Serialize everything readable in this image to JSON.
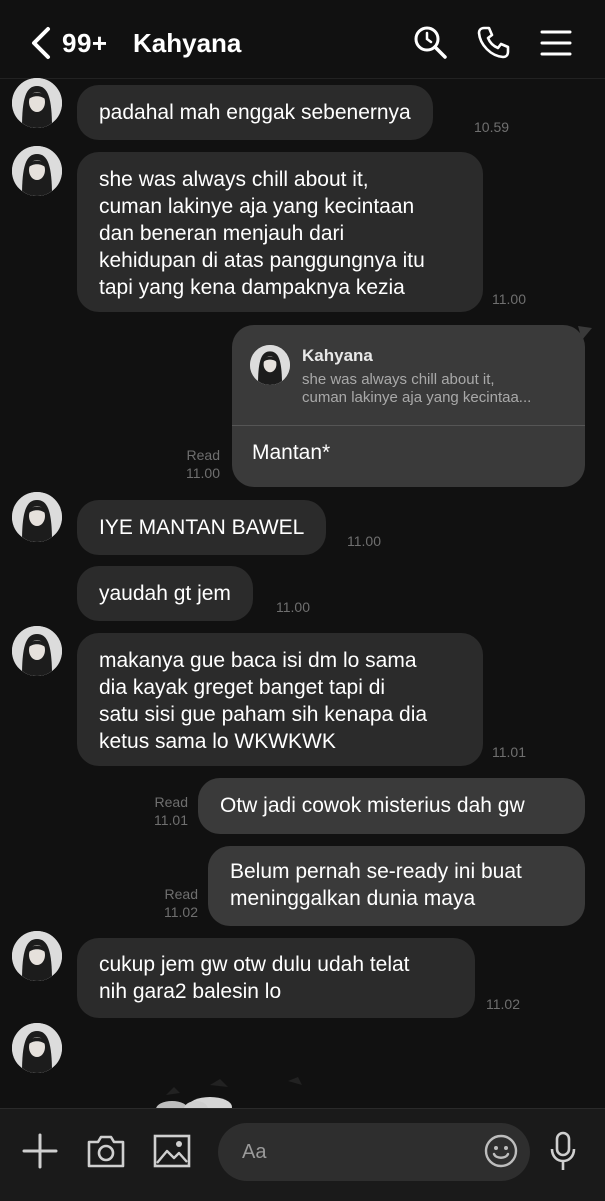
{
  "header": {
    "unread_count": "99+",
    "chat_name": "Kahyana"
  },
  "messages": [
    {
      "dir": "in",
      "lines": [
        "padahal mah enggak sebenernya"
      ],
      "time": "10.59"
    },
    {
      "dir": "in",
      "lines": [
        "she was always chill about it,",
        "cuman lakinye aja yang kecintaan",
        "dan beneran menjauh dari",
        "kehidupan di atas panggungnya itu",
        "tapi yang kena dampaknya kezia"
      ],
      "time": "11.00"
    },
    {
      "dir": "in",
      "lines": [
        "IYE MANTAN BAWEL"
      ],
      "time": "11.00"
    },
    {
      "dir": "in",
      "lines": [
        "yaudah gt jem"
      ],
      "time": "11.00"
    },
    {
      "dir": "in",
      "lines": [
        "makanya gue baca isi dm lo sama",
        "dia kayak greget banget tapi di",
        "satu sisi gue paham sih kenapa dia",
        "ketus sama lo WKWKWK"
      ],
      "time": "11.01"
    },
    {
      "dir": "out",
      "lines": [
        "Otw jadi cowok misterius dah gw"
      ],
      "status": "Read",
      "time": "11.01"
    },
    {
      "dir": "out",
      "lines": [
        "Belum pernah se-ready ini buat",
        "meninggalkan dunia maya"
      ],
      "status": "Read",
      "time": "11.02"
    },
    {
      "dir": "in",
      "lines": [
        "cukup jem gw otw dulu udah telat",
        "nih gara2 balesin lo"
      ],
      "time": "11.02"
    }
  ],
  "reply": {
    "quoted_name": "Kahyana",
    "quoted_line1": "she was always chill about it,",
    "quoted_line2": "cuman lakinye aja yang kecintaa...",
    "text": "Mantan*",
    "status": "Read",
    "time": "11.00"
  },
  "input": {
    "placeholder": "Aa"
  },
  "icons": {
    "back": "chevron-left-icon",
    "search": "search-icon",
    "call": "phone-icon",
    "menu": "hamburger-menu-icon",
    "add": "plus-icon",
    "camera": "camera-icon",
    "gallery": "image-icon",
    "emoji": "smiley-icon",
    "voice": "microphone-icon"
  },
  "colors": {
    "background": "#111111",
    "incoming_bubble": "#2b2b2b",
    "outgoing_bubble": "#3a3a3a",
    "timestamp": "#6f6f6f"
  }
}
